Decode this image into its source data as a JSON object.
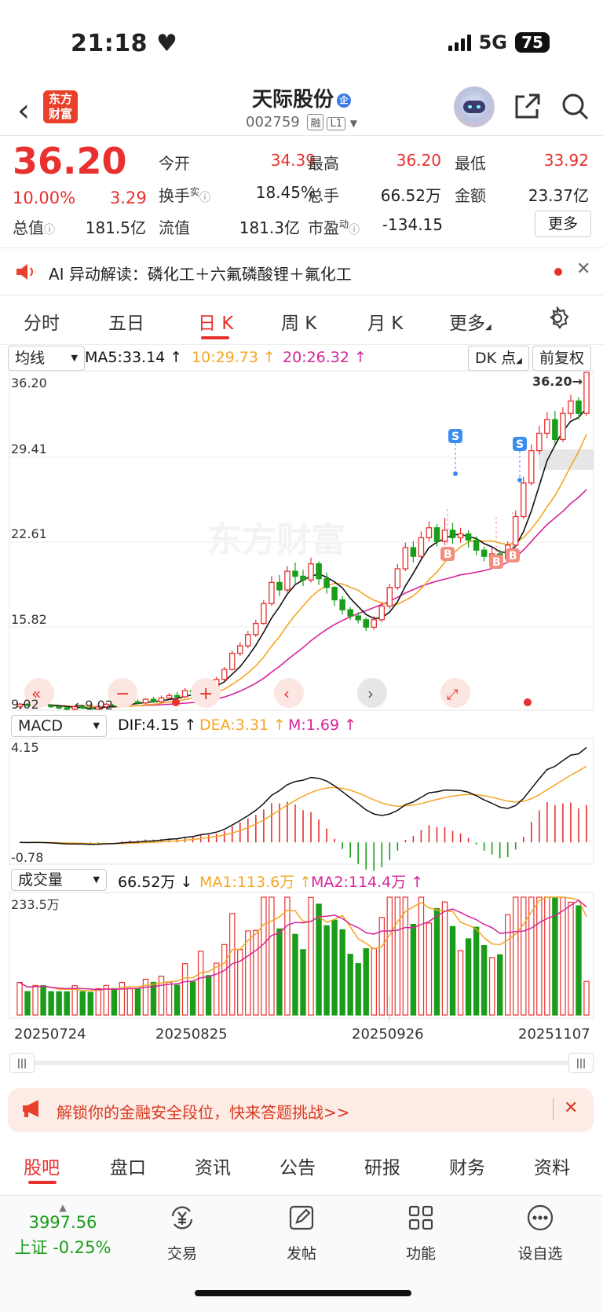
{
  "status_bar": {
    "time": "21:18",
    "network": "5G",
    "battery": "75"
  },
  "header": {
    "back_icon": "chevron-left-icon",
    "logo_text": "东方财富",
    "stock_name": "天际股份",
    "stock_name_badge": "企",
    "stock_code": "002759",
    "tags": [
      "融",
      "L1"
    ]
  },
  "quote": {
    "price": "36.20",
    "change_pct": "10.00%",
    "change": "3.29",
    "fields": [
      {
        "label": "今开",
        "value": "34.39",
        "color": "#e8312f"
      },
      {
        "label": "最高",
        "value": "36.20",
        "color": "#e8312f"
      },
      {
        "label": "最低",
        "value": "33.92",
        "color": "#e8312f"
      },
      {
        "label": "换手",
        "sup": "实",
        "value": "18.45%",
        "color": "#222"
      },
      {
        "label": "总手",
        "value": "66.52万",
        "color": "#222"
      },
      {
        "label": "金额",
        "value": "23.37亿",
        "color": "#222"
      },
      {
        "label": "总值",
        "value": "181.5亿",
        "color": "#222"
      },
      {
        "label": "流值",
        "value": "181.3亿",
        "color": "#222"
      },
      {
        "label": "市盈",
        "sup": "动",
        "value": "-134.15",
        "color": "#222"
      }
    ],
    "more_label": "更多"
  },
  "ai_bar": {
    "text": "AI 异动解读：磷化工＋六氟磷酸锂＋氟化工"
  },
  "kline_tabs": {
    "items": [
      "分时",
      "五日",
      "日 K",
      "周 K",
      "月 K",
      "更多"
    ],
    "active": "日 K"
  },
  "ma_row": {
    "select": "均线",
    "ma5": "MA5:33.14",
    "ma10": "10:29.73",
    "ma20": "20:26.32",
    "dk": "DK 点",
    "adjust": "前复权"
  },
  "price_axis": {
    "labels": [
      "36.20",
      "29.41",
      "22.61",
      "15.82",
      "9.02"
    ],
    "last_price_tag": "36.20→",
    "min_price_tag": "9.02"
  },
  "watermark": "东方财富",
  "macd_row": {
    "select": "MACD",
    "dif": "DIF:4.15",
    "dea": "DEA:3.31",
    "m": "M:1.69",
    "axis_top": "4.15",
    "axis_bottom": "-0.78"
  },
  "volume_row": {
    "select": "成交量",
    "vol": "66.52万",
    "ma1": "MA1:113.6万",
    "ma2": "MA2:114.4万",
    "axis_top": "233.5万"
  },
  "date_axis": [
    "20250724",
    "20250825",
    "20250926",
    "20251107"
  ],
  "colors": {
    "up": "#e8312f",
    "down": "#1a9d1a",
    "ma5": "#111111",
    "ma10": "#f5a623",
    "ma20": "#d6249a",
    "accent": "#e8312f"
  },
  "chart_data": {
    "type": "candlestick",
    "ylim": [
      9.02,
      36.2
    ],
    "candles": [
      [
        9.3,
        9.5,
        9.1,
        9.6
      ],
      [
        9.5,
        9.4,
        9.3,
        9.6
      ],
      [
        9.4,
        9.6,
        9.3,
        9.7
      ],
      [
        9.6,
        9.4,
        9.3,
        9.7
      ],
      [
        9.4,
        9.3,
        9.2,
        9.5
      ],
      [
        9.3,
        9.2,
        9.1,
        9.4
      ],
      [
        9.2,
        9.1,
        9.0,
        9.3
      ],
      [
        9.1,
        9.3,
        9.0,
        9.4
      ],
      [
        9.3,
        9.2,
        9.1,
        9.4
      ],
      [
        9.2,
        9.1,
        9.02,
        9.3
      ],
      [
        9.1,
        9.3,
        9.1,
        9.4
      ],
      [
        9.3,
        9.5,
        9.2,
        9.6
      ],
      [
        9.5,
        9.4,
        9.3,
        9.7
      ],
      [
        9.4,
        9.6,
        9.3,
        9.8
      ],
      [
        9.6,
        9.7,
        9.5,
        9.9
      ],
      [
        9.7,
        9.6,
        9.5,
        9.9
      ],
      [
        9.6,
        9.9,
        9.5,
        10.0
      ],
      [
        9.9,
        9.7,
        9.6,
        10.1
      ],
      [
        9.7,
        10.0,
        9.6,
        10.2
      ],
      [
        10.0,
        10.2,
        9.9,
        10.4
      ],
      [
        10.2,
        10.1,
        10.0,
        10.5
      ],
      [
        10.1,
        10.6,
        10.0,
        10.8
      ],
      [
        10.6,
        10.5,
        10.3,
        10.9
      ],
      [
        10.5,
        11.2,
        10.4,
        11.4
      ],
      [
        11.2,
        11.0,
        10.8,
        11.5
      ],
      [
        11.0,
        11.5,
        10.9,
        11.7
      ],
      [
        11.5,
        12.3,
        11.4,
        12.5
      ],
      [
        12.3,
        13.6,
        12.2,
        13.8
      ],
      [
        13.6,
        14.2,
        13.4,
        14.5
      ],
      [
        14.2,
        15.1,
        14.0,
        15.4
      ],
      [
        15.1,
        16.0,
        14.9,
        16.3
      ],
      [
        16.0,
        17.6,
        15.9,
        17.9
      ],
      [
        17.6,
        19.3,
        17.4,
        19.8
      ],
      [
        19.3,
        18.7,
        18.2,
        19.9
      ],
      [
        18.7,
        20.2,
        18.5,
        20.6
      ],
      [
        20.2,
        19.8,
        19.2,
        20.9
      ],
      [
        19.8,
        19.5,
        19.0,
        20.3
      ],
      [
        19.5,
        20.8,
        19.3,
        21.3
      ],
      [
        20.8,
        19.6,
        19.1,
        21.0
      ],
      [
        19.6,
        18.9,
        18.4,
        20.1
      ],
      [
        18.9,
        17.9,
        17.4,
        19.0
      ],
      [
        17.9,
        17.1,
        16.7,
        18.2
      ],
      [
        17.1,
        16.6,
        16.3,
        17.3
      ],
      [
        16.6,
        16.3,
        16.0,
        16.9
      ],
      [
        16.3,
        15.7,
        15.4,
        16.5
      ],
      [
        15.7,
        16.3,
        15.5,
        16.6
      ],
      [
        16.3,
        17.4,
        16.1,
        17.7
      ],
      [
        17.4,
        18.9,
        17.2,
        19.2
      ],
      [
        18.9,
        20.4,
        18.7,
        20.8
      ],
      [
        20.4,
        22.1,
        20.2,
        22.5
      ],
      [
        22.1,
        21.4,
        20.9,
        22.6
      ],
      [
        21.4,
        22.9,
        21.2,
        23.4
      ],
      [
        22.9,
        23.7,
        22.6,
        24.2
      ],
      [
        23.7,
        22.6,
        22.2,
        24.0
      ],
      [
        22.6,
        23.5,
        22.3,
        24.5
      ],
      [
        23.5,
        22.9,
        22.4,
        24.1
      ],
      [
        22.9,
        23.2,
        22.5,
        23.7
      ],
      [
        23.2,
        22.7,
        22.1,
        23.5
      ],
      [
        22.7,
        21.9,
        21.5,
        23.0
      ],
      [
        21.9,
        21.4,
        21.0,
        22.2
      ],
      [
        21.4,
        21.6,
        21.0,
        22.1
      ],
      [
        21.6,
        21.2,
        20.9,
        21.9
      ],
      [
        21.2,
        22.3,
        21.0,
        22.6
      ],
      [
        22.3,
        24.6,
        22.1,
        25.1
      ],
      [
        24.6,
        27.3,
        24.4,
        27.8
      ],
      [
        27.3,
        29.9,
        27.1,
        30.4
      ],
      [
        29.9,
        31.3,
        29.6,
        31.9
      ],
      [
        31.3,
        32.4,
        30.9,
        33.0
      ],
      [
        32.4,
        30.8,
        30.4,
        33.1
      ],
      [
        30.8,
        32.9,
        30.6,
        33.4
      ],
      [
        32.9,
        33.9,
        32.5,
        34.4
      ],
      [
        33.9,
        32.9,
        32.4,
        34.2
      ],
      [
        32.9,
        36.2,
        32.7,
        36.2
      ]
    ],
    "macd": {
      "dif_end": 4.15,
      "dea_end": 3.31,
      "m_end": 1.69,
      "ylim": [
        -0.78,
        4.15
      ]
    },
    "volume": {
      "unit": "万",
      "ylim": [
        0,
        233.5
      ],
      "last": 66.52
    }
  },
  "promo": {
    "text": "解锁你的金融安全段位，快来答题挑战>>"
  },
  "bottom_tabs": {
    "items": [
      "股吧",
      "盘口",
      "资讯",
      "公告",
      "研报",
      "财务",
      "资料"
    ],
    "active": "股吧"
  },
  "index": {
    "value": "3997.56",
    "name": "上证",
    "pct": "-0.25%"
  },
  "nav": [
    {
      "label": "交易",
      "icon": "yuan-exchange-icon"
    },
    {
      "label": "发帖",
      "icon": "edit-icon"
    },
    {
      "label": "功能",
      "icon": "grid-icon"
    },
    {
      "label": "设自选",
      "icon": "more-dots-icon"
    }
  ]
}
